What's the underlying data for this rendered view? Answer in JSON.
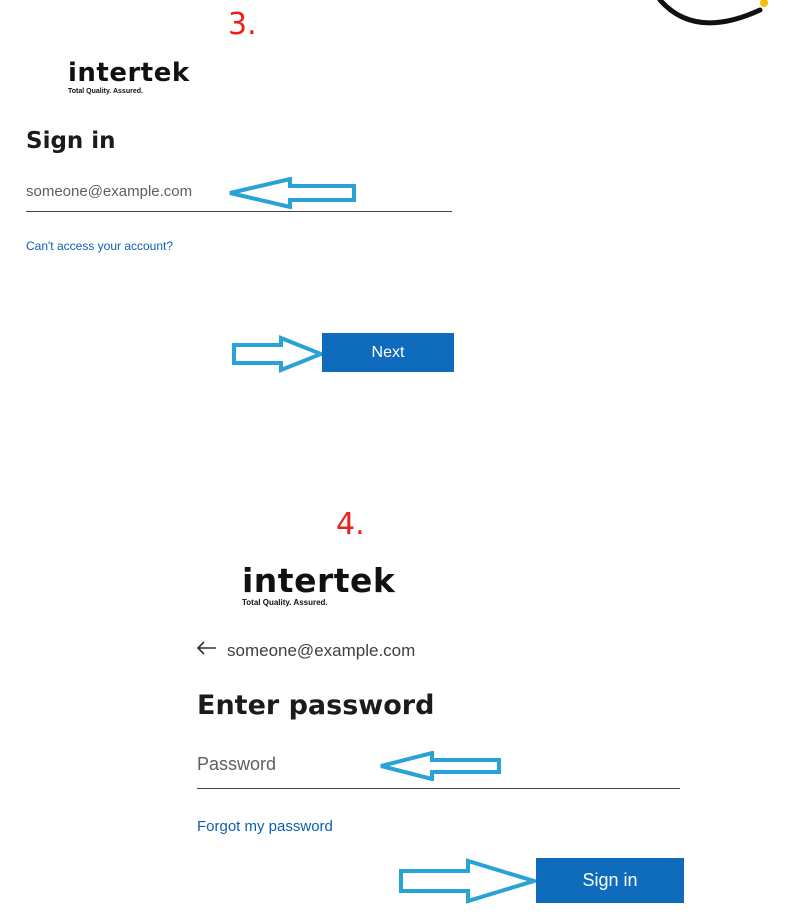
{
  "corner_circle_fragment": {
    "stroke_color": "#111111",
    "accent_color": "#f2c200"
  },
  "step3": {
    "step_number": "3.",
    "logo": {
      "wordmark": "intertek",
      "tagline": "Total Quality. Assured."
    },
    "heading": "Sign in",
    "email_input": {
      "value": "someone@example.com"
    },
    "cant_access_link": "Can't access your account?",
    "next_button": "Next"
  },
  "step4": {
    "step_number": "4.",
    "logo": {
      "wordmark": "intertek",
      "tagline": "Total Quality. Assured."
    },
    "back_arrow_icon": "left-arrow-icon",
    "account_email": "someone@example.com",
    "heading": "Enter password",
    "password_input": {
      "placeholder": "Password"
    },
    "forgot_password_link": "Forgot my password",
    "sign_in_button": "Sign in"
  },
  "colors": {
    "accent_primary": "#0f6cbd",
    "link": "#0a5fb4",
    "annotation_arrow": "#29a3d6",
    "step_number": "#e8221b"
  },
  "annotation_icons": [
    "hollow-arrow-icon"
  ]
}
